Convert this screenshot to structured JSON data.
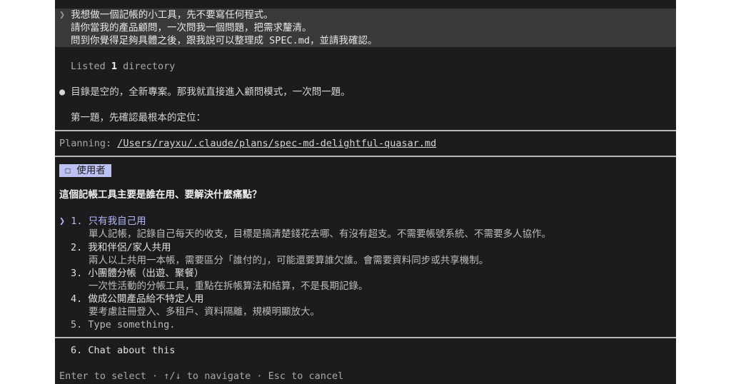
{
  "prompt": {
    "chevron": "❯",
    "lines": [
      "我想做一個記帳的小工具，先不要寫任何程式。",
      "請你當我的產品顧問，一次問我一個問題，把需求釐清。",
      "問到你覺得足夠具體之後，跟我說可以整理成 SPEC.md，並請我確認。"
    ]
  },
  "listed": {
    "prefix": "Listed ",
    "count": "1",
    "suffix": " directory"
  },
  "assistant": {
    "bullet": "●",
    "message": "目錄是空的，全新專案。那我就直接進入顧問模式，一次問一題。",
    "followup": "第一題，先確認最根本的定位："
  },
  "planning": {
    "label": "Planning: ",
    "path": "/Users/rayxu/.claude/plans/spec-md-delightful-quasar.md"
  },
  "question": {
    "tag": "☐ 使用者",
    "title": "這個記帳工具主要是誰在用、要解決什麼痛點？"
  },
  "options": [
    {
      "num": "1.",
      "label": "只有我自己用",
      "desc": "單人記帳，記錄自己每天的收支，目標是搞清楚錢花去哪、有沒有超支。不需要帳號系統、不需要多人協作。"
    },
    {
      "num": "2.",
      "label": "我和伴侶/家人共用",
      "desc": "兩人以上共用一本帳，需要區分「誰付的」，可能還要算誰欠誰。會需要資料同步或共享機制。"
    },
    {
      "num": "3.",
      "label": "小團體分帳（出遊、聚餐）",
      "desc": "一次性活動的分帳工具，重點在拆帳算法和結算，不是長期記錄。"
    },
    {
      "num": "4.",
      "label": "做成公開產品給不特定人用",
      "desc": "要考慮註冊登入、多租戶、資料隔離，規模明顯放大。"
    },
    {
      "num": "5.",
      "label": "Type something.",
      "desc": ""
    }
  ],
  "chat_option": {
    "num": "6.",
    "label": "Chat about this"
  },
  "selector": "❯",
  "footer": "Enter to select · ↑/↓ to navigate · Esc to cancel"
}
